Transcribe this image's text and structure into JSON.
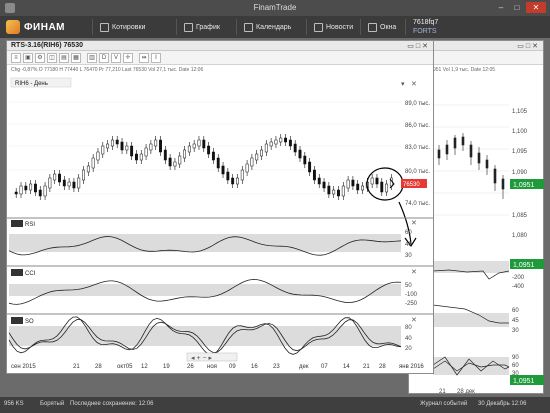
{
  "window": {
    "title": "FinamTrade"
  },
  "toolbar": {
    "logo": "ФИНАМ",
    "buttons": [
      {
        "label": "Котировки",
        "icon": "quotes-icon"
      },
      {
        "label": "График",
        "icon": "chart-icon"
      },
      {
        "label": "Календарь",
        "icon": "calendar-icon"
      },
      {
        "label": "Новости",
        "icon": "news-icon"
      },
      {
        "label": "Окна",
        "icon": "windows-icon"
      }
    ],
    "ticker": {
      "value": "7618fq7",
      "market": "FORTS"
    }
  },
  "chart_window": {
    "title": "RTS-3.16(RIH6) 76530",
    "info": "Chg -0,87%  O 77180  H 77440  L 76470  Pr 77,210  Last 76530  Vol 27,1 тыс.  Date 12:06",
    "instrument_label": "RIH6 - День",
    "price_badge": "76530",
    "price_axis": [
      "89,0 тыс.",
      "86,0 тыс.",
      "83,0 тыс.",
      "80,0 тыс.",
      "74,0 тыс."
    ],
    "indicators": [
      {
        "name": "RSI",
        "axis": [
          "60",
          "40",
          "30"
        ]
      },
      {
        "name": "CCI",
        "axis": [
          "50",
          "-100",
          "-250"
        ]
      },
      {
        "name": "SO",
        "axis": [
          "80",
          "40",
          "20"
        ]
      }
    ],
    "time_axis": [
      "сен 2015",
      "21",
      "28",
      "окт05",
      "12",
      "19",
      "26",
      "ноя",
      "09",
      "16",
      "23",
      "дек",
      "07",
      "14",
      "21",
      "28",
      "янв 2016"
    ],
    "tools": [
      "D",
      "V"
    ]
  },
  "side_window": {
    "info": "951 Vol 1,9 тыс. Date 12:05",
    "price_axis": [
      "1,105",
      "1,100",
      "1,095",
      "1,090",
      "1,085",
      "1,080"
    ],
    "badge": "1,0951",
    "rsi_axis": [
      "-200",
      "-400"
    ],
    "cci_axis": [
      "60",
      "45",
      "30"
    ],
    "so_axis": [
      "90",
      "60",
      "30"
    ],
    "badge2": "1,0951",
    "time_axis": [
      "21",
      "28 дек"
    ]
  },
  "status": {
    "left": "956 KS",
    "mode": "Борятый",
    "saved": "Последнее сохранение: 12:06",
    "journal": "Журнал событий",
    "datetime": "30 Декабрь 12:06"
  }
}
